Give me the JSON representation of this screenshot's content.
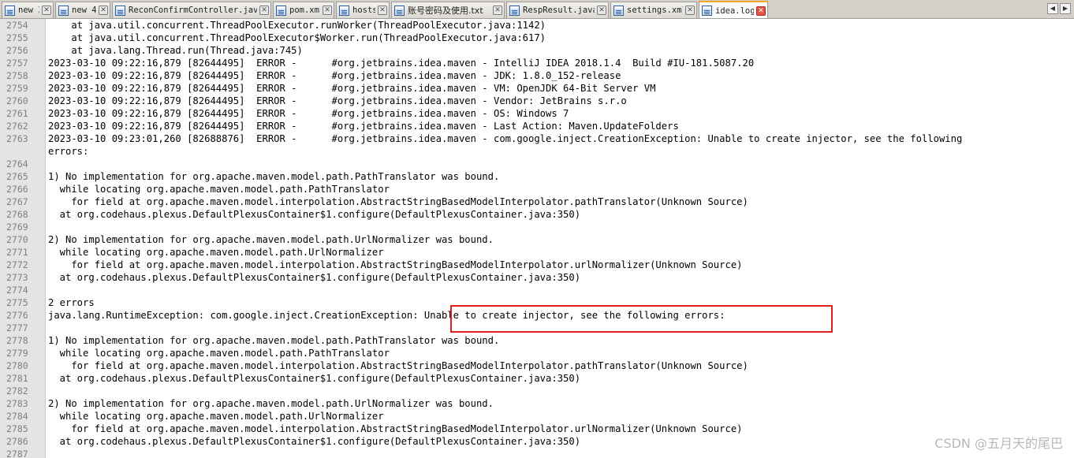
{
  "tabs": [
    {
      "label": "new 3"
    },
    {
      "label": "new 4"
    },
    {
      "label": "ReconConfirmController.java"
    },
    {
      "label": "pom.xml"
    },
    {
      "label": "hosts"
    },
    {
      "label": "账号密码及使用.txt"
    },
    {
      "label": "RespResult.java"
    },
    {
      "label": "settings.xml"
    },
    {
      "label": "idea.log"
    }
  ],
  "active_tab": "idea.log",
  "tab_close_glyph": "✕",
  "nav": {
    "left_glyph": "◀",
    "right_glyph": "▶"
  },
  "lines": [
    {
      "num": "2754",
      "text": "    at java.util.concurrent.ThreadPoolExecutor.runWorker(ThreadPoolExecutor.java:1142)"
    },
    {
      "num": "2755",
      "text": "    at java.util.concurrent.ThreadPoolExecutor$Worker.run(ThreadPoolExecutor.java:617)"
    },
    {
      "num": "2756",
      "text": "    at java.lang.Thread.run(Thread.java:745)"
    },
    {
      "num": "2757",
      "text": "2023-03-10 09:22:16,879 [82644495]  ERROR -      #org.jetbrains.idea.maven - IntelliJ IDEA 2018.1.4  Build #IU-181.5087.20"
    },
    {
      "num": "2758",
      "text": "2023-03-10 09:22:16,879 [82644495]  ERROR -      #org.jetbrains.idea.maven - JDK: 1.8.0_152-release"
    },
    {
      "num": "2759",
      "text": "2023-03-10 09:22:16,879 [82644495]  ERROR -      #org.jetbrains.idea.maven - VM: OpenJDK 64-Bit Server VM"
    },
    {
      "num": "2760",
      "text": "2023-03-10 09:22:16,879 [82644495]  ERROR -      #org.jetbrains.idea.maven - Vendor: JetBrains s.r.o"
    },
    {
      "num": "2761",
      "text": "2023-03-10 09:22:16,879 [82644495]  ERROR -      #org.jetbrains.idea.maven - OS: Windows 7"
    },
    {
      "num": "2762",
      "text": "2023-03-10 09:22:16,879 [82644495]  ERROR -      #org.jetbrains.idea.maven - Last Action: Maven.UpdateFolders"
    },
    {
      "num": "2763",
      "text": "2023-03-10 09:23:01,260 [82688876]  ERROR -      #org.jetbrains.idea.maven - com.google.inject.CreationException: Unable to create injector, see the following"
    },
    {
      "num": "",
      "text": "errors:"
    },
    {
      "num": "2764",
      "text": ""
    },
    {
      "num": "2765",
      "text": "1) No implementation for org.apache.maven.model.path.PathTranslator was bound."
    },
    {
      "num": "2766",
      "text": "  while locating org.apache.maven.model.path.PathTranslator"
    },
    {
      "num": "2767",
      "text": "    for field at org.apache.maven.model.interpolation.AbstractStringBasedModelInterpolator.pathTranslator(Unknown Source)"
    },
    {
      "num": "2768",
      "text": "  at org.codehaus.plexus.DefaultPlexusContainer$1.configure(DefaultPlexusContainer.java:350)"
    },
    {
      "num": "2769",
      "text": ""
    },
    {
      "num": "2770",
      "text": "2) No implementation for org.apache.maven.model.path.UrlNormalizer was bound."
    },
    {
      "num": "2771",
      "text": "  while locating org.apache.maven.model.path.UrlNormalizer"
    },
    {
      "num": "2772",
      "text": "    for field at org.apache.maven.model.interpolation.AbstractStringBasedModelInterpolator.urlNormalizer(Unknown Source)"
    },
    {
      "num": "2773",
      "text": "  at org.codehaus.plexus.DefaultPlexusContainer$1.configure(DefaultPlexusContainer.java:350)"
    },
    {
      "num": "2774",
      "text": ""
    },
    {
      "num": "2775",
      "text": "2 errors"
    },
    {
      "num": "2776",
      "text": "java.lang.RuntimeException: com.google.inject.CreationException: Unable to create injector, see the following errors:"
    },
    {
      "num": "2777",
      "text": ""
    },
    {
      "num": "2778",
      "text": "1) No implementation for org.apache.maven.model.path.PathTranslator was bound."
    },
    {
      "num": "2779",
      "text": "  while locating org.apache.maven.model.path.PathTranslator"
    },
    {
      "num": "2780",
      "text": "    for field at org.apache.maven.model.interpolation.AbstractStringBasedModelInterpolator.pathTranslator(Unknown Source)"
    },
    {
      "num": "2781",
      "text": "  at org.codehaus.plexus.DefaultPlexusContainer$1.configure(DefaultPlexusContainer.java:350)"
    },
    {
      "num": "2782",
      "text": ""
    },
    {
      "num": "2783",
      "text": "2) No implementation for org.apache.maven.model.path.UrlNormalizer was bound."
    },
    {
      "num": "2784",
      "text": "  while locating org.apache.maven.model.path.UrlNormalizer"
    },
    {
      "num": "2785",
      "text": "    for field at org.apache.maven.model.interpolation.AbstractStringBasedModelInterpolator.urlNormalizer(Unknown Source)"
    },
    {
      "num": "2786",
      "text": "  at org.codehaus.plexus.DefaultPlexusContainer$1.configure(DefaultPlexusContainer.java:350)"
    },
    {
      "num": "2787",
      "text": ""
    }
  ],
  "annotation_color": "#e02020",
  "watermark": "CSDN @五月天的尾巴"
}
